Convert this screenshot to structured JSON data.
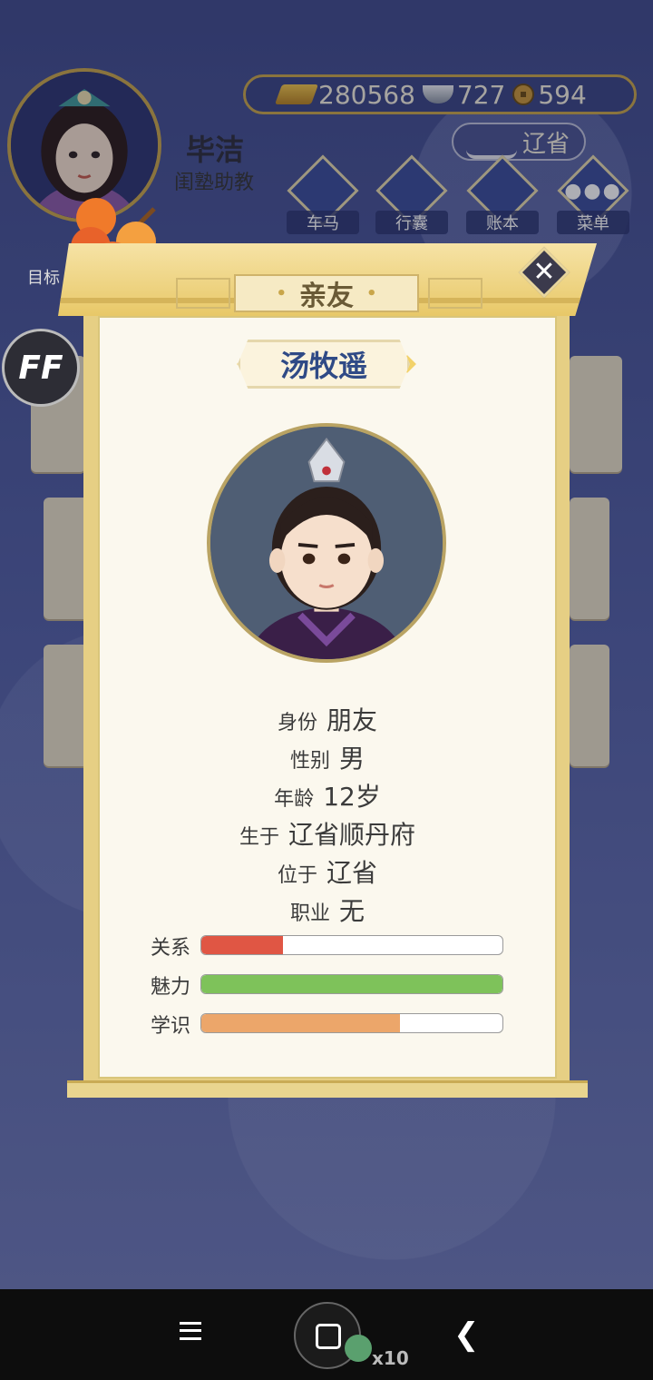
{
  "player": {
    "name": "毕洁",
    "title": "闺塾助教"
  },
  "resources": {
    "gold": "280568",
    "silver": "727",
    "coins": "594",
    "location": "辽省"
  },
  "menu": [
    {
      "label": "车马",
      "icon": "carriage-icon"
    },
    {
      "label": "行囊",
      "icon": "bag-icon"
    },
    {
      "label": "账本",
      "icon": "ledger-icon"
    },
    {
      "label": "菜单",
      "icon": "more-icon"
    }
  ],
  "sidebar": {
    "goal_label": "目标",
    "ff_label": "FF"
  },
  "modal": {
    "title": "亲友",
    "person_name": "汤牧遥",
    "info": [
      {
        "key": "身份",
        "value": "朋友"
      },
      {
        "key": "性别",
        "value": "男"
      },
      {
        "key": "年龄",
        "value": "12岁"
      },
      {
        "key": "生于",
        "value": "辽省顺丹府"
      },
      {
        "key": "位于",
        "value": "辽省"
      },
      {
        "key": "职业",
        "value": "无"
      }
    ],
    "stats": [
      {
        "label": "关系",
        "value": 0.27,
        "color": "#e05644"
      },
      {
        "label": "魅力",
        "value": 1.0,
        "color": "#7ec25a"
      },
      {
        "label": "学识",
        "value": 0.66,
        "color": "#eca66a"
      }
    ]
  },
  "navbar": {
    "badge": "x10"
  },
  "colors": {
    "accent_gold": "#c9a64a",
    "name_blue": "#2f4a86",
    "panel_bg": "#fbf8ee"
  }
}
